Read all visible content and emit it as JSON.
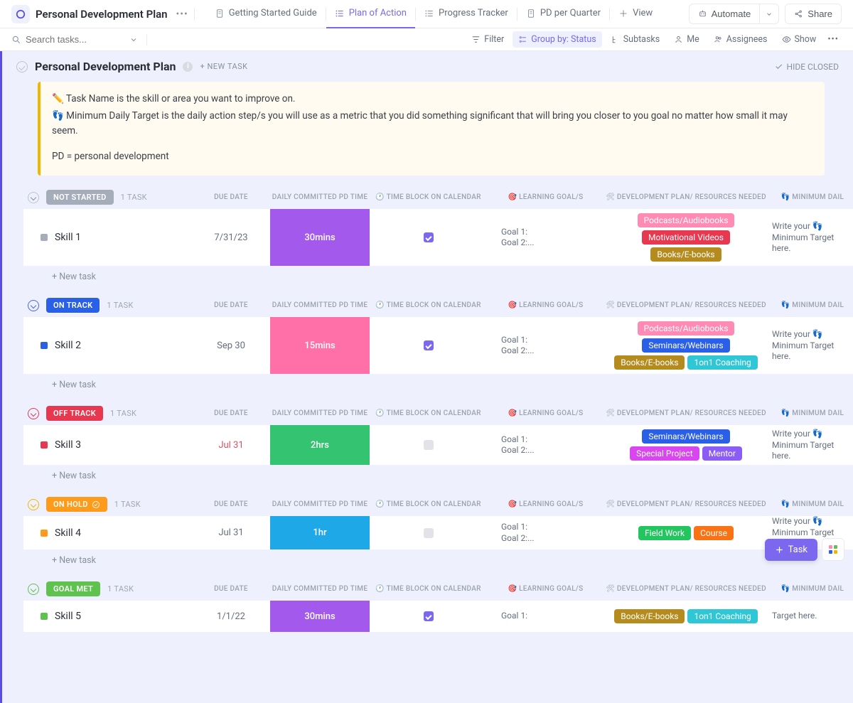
{
  "header": {
    "title": "Personal Development Plan",
    "tabs": [
      {
        "label": "Getting Started Guide",
        "icon": "doc"
      },
      {
        "label": "Plan of Action",
        "icon": "list",
        "active": true
      },
      {
        "label": "Progress Tracker",
        "icon": "list"
      },
      {
        "label": "PD per Quarter",
        "icon": "doc"
      },
      {
        "label": "View",
        "icon": "plus"
      }
    ],
    "automate": "Automate",
    "share": "Share"
  },
  "toolbar": {
    "search_placeholder": "Search tasks...",
    "filter": "Filter",
    "group_by": "Group by: Status",
    "subtasks": "Subtasks",
    "me": "Me",
    "assignees": "Assignees",
    "show": "Show"
  },
  "list": {
    "title": "Personal Development Plan",
    "new_task": "+ NEW TASK",
    "hide_closed": "HIDE CLOSED"
  },
  "banner": {
    "line1": "✏️ Task Name is the skill or area you want to improve on.",
    "line2": "👣 Minimum Daily Target is the daily action step/s you will use as a metric that you did something significant that will bring you closer to you goal no matter how small it may seem.",
    "line3": "PD = personal development"
  },
  "columns": {
    "due": "DUE DATE",
    "time": "DAILY COMMITTED PD TIME",
    "block": "🕐 TIME BLOCK ON CALENDAR",
    "goals": "🎯 LEARNING GOAL/S",
    "plan": "🛠 DEVELOPMENT PLAN/ RESOURCES NEEDED",
    "min": "👣 MINIMUM DAIL"
  },
  "new_task_row": "+ New task",
  "tag_colors": {
    "Podcasts/Audiobooks": "#ff8ab4",
    "Motivational Videos": "#e8384f",
    "Books/E-books": "#b58b1e",
    "Seminars/Webinars": "#2a5fe8",
    "1on1 Coaching": "#2fc7d6",
    "Special Project": "#d946ef",
    "Mentor": "#8b5cf6",
    "Field Work": "#22c55e",
    "Course": "#f97316"
  },
  "groups": [
    {
      "id": "not-started",
      "status": "NOT STARTED",
      "status_color": "#a6adba",
      "count": "1 TASK",
      "tasks": [
        {
          "name": "Skill 1",
          "sq": "#a6adba",
          "due": "7/31/23",
          "overdue": false,
          "time": "30mins",
          "time_bg": "#a259ec",
          "checked": true,
          "goals": "Goal 1:\nGoal 2:...",
          "tags": [
            "Podcasts/Audiobooks",
            "Motivational Videos",
            "Books/E-books"
          ],
          "min": "Write your 👣 Minimum Target here."
        }
      ]
    },
    {
      "id": "on-track",
      "status": "ON TRACK",
      "status_color": "#2a5fe8",
      "count": "1 TASK",
      "tasks": [
        {
          "name": "Skill 2",
          "sq": "#2a5fe8",
          "due": "Sep 30",
          "overdue": false,
          "time": "15mins",
          "time_bg": "#ff6fa8",
          "checked": true,
          "goals": "Goal 1:\nGoal 2:...",
          "tags": [
            "Podcasts/Audiobooks",
            "Seminars/Webinars",
            "Books/E-books",
            "1on1 Coaching"
          ],
          "min": "Write your 👣 Minimum Target here."
        }
      ]
    },
    {
      "id": "off-track",
      "status": "OFF TRACK",
      "status_color": "#e8384f",
      "count": "1 TASK",
      "tasks": [
        {
          "name": "Skill 3",
          "sq": "#e8384f",
          "due": "Jul 31",
          "overdue": true,
          "time": "2hrs",
          "time_bg": "#34c471",
          "checked": false,
          "goals": "Goal 1:\nGoal 2:...",
          "tags": [
            "Seminars/Webinars",
            "Special Project",
            "Mentor"
          ],
          "min": "Write your 👣 Minimum Target here."
        }
      ]
    },
    {
      "id": "on-hold",
      "status": "ON HOLD",
      "status_color": "#ff9b1a",
      "count": "1 TASK",
      "has_icon": true,
      "tasks": [
        {
          "name": "Skill 4",
          "sq": "#ff9b1a",
          "due": "Jul 31",
          "overdue": false,
          "time": "1hr",
          "time_bg": "#1fa8e8",
          "checked": false,
          "goals": "Goal 1:\nGoal 2:...",
          "tags": [
            "Field Work",
            "Course"
          ],
          "min": "Write your 👣 Minimum Target here."
        }
      ]
    },
    {
      "id": "goal-met",
      "status": "GOAL MET",
      "status_color": "#5fc24e",
      "count": "1 TASK",
      "tasks": [
        {
          "name": "Skill 5",
          "sq": "#5fc24e",
          "due": "1/1/22",
          "overdue": false,
          "time": "30mins",
          "time_bg": "#a259ec",
          "checked": true,
          "goals": "Goal 1:",
          "tags": [
            "Books/E-books",
            "1on1 Coaching"
          ],
          "min": "Target here."
        }
      ]
    }
  ],
  "float": {
    "task": "Task"
  }
}
